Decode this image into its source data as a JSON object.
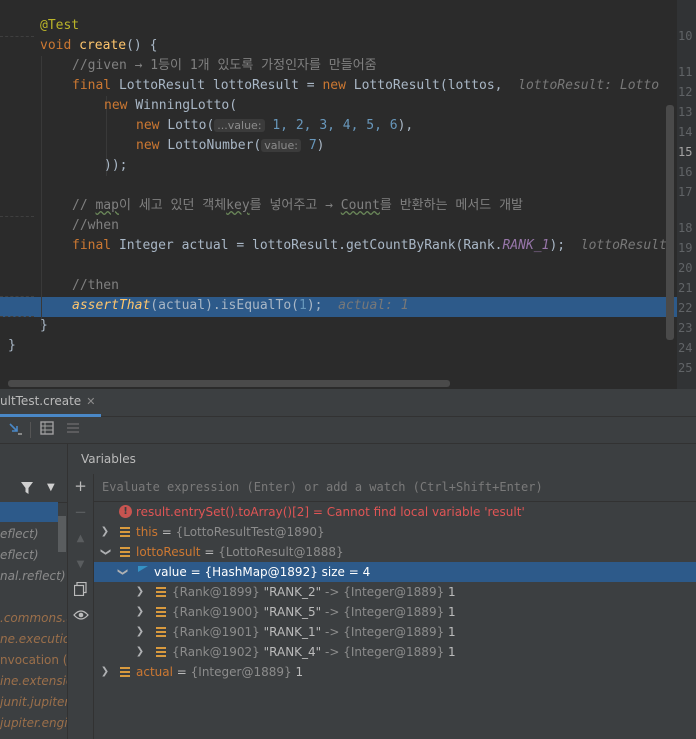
{
  "editor": {
    "line_numbers": [
      "10",
      "11",
      "12",
      "13",
      "14",
      "15",
      "16",
      "17",
      "18",
      "19",
      "20",
      "21",
      "22",
      "23",
      "24",
      "25"
    ],
    "code": {
      "ann_test": "@Test",
      "kw_void": "void ",
      "fn_create": "create",
      "sig_rest": "() {",
      "c_given": "//given → 1등이 1개 있도록 가정인자를 만들어줌",
      "kw_final1": "final ",
      "l3_a": "LottoResult lottoResult = ",
      "kw_new1": "new ",
      "l3_b": "LottoResult(lottos,",
      "l3_hint": "lottoResult: Lotto",
      "kw_new2": "new ",
      "l4": "WinningLotto(",
      "kw_new3": "new ",
      "l5_a": "Lotto(",
      "l5_param": "...value:",
      "l5_nums": "1, 2, 3, 4, 5, 6",
      "l5_end": "),",
      "kw_new4": "new ",
      "l6_a": "LottoNumber(",
      "l6_param": "value:",
      "l6_num": "7",
      "l6_end": ")",
      "l7": "));",
      "c_map_pre": "// ",
      "c_map_word": "map",
      "c_map_mid": "이 세고 있던 객체",
      "c_key_word": "key",
      "c_map_mid2": "를 넣어주고 → ",
      "c_count_word": "Count",
      "c_map_end": "를 반환하는 메서드 개발",
      "c_when": "//when",
      "kw_final2": "final ",
      "l_when_a": "Integer actual = lottoResult.getCountByRank(Rank.",
      "l_when_field": "RANK_1",
      "l_when_end": ");",
      "l_when_hint": "lottoResult",
      "c_then": "//then",
      "l_then_fn": "assertThat",
      "l_then_a": "(actual).isEqualTo(",
      "l_then_num": "1",
      "l_then_end": ");",
      "l_then_hint": "actual: 1",
      "close1": "}",
      "close2": "}"
    }
  },
  "debugger": {
    "tab_title": "ultTest.create",
    "tab_close": "✕",
    "variables_title": "Variables",
    "eval_placeholder": "Evaluate expression (Enter) or add a watch (Ctrl+Shift+Enter)",
    "frames": [
      "eflect)",
      "eflect)",
      "nal.reflect)",
      ".commons.u",
      "ne.execution)",
      "nvocation (or",
      "ine.extensio",
      "junit.jupiter.",
      "jupiter.engin"
    ]
  },
  "variables": [
    {
      "name": "result.entrySet().toArray()[2]",
      "eq": " = ",
      "value": "Cannot find local variable 'result'"
    },
    {
      "name": "this",
      "eq": " = ",
      "ref": "{LottoResultTest@1890}"
    },
    {
      "name": "lottoResult",
      "eq": " = ",
      "ref": "{LottoResult@1888}"
    },
    {
      "name": "value",
      "eq": " = ",
      "ref": "{HashMap@1892}",
      "extra": "size = 4"
    },
    {
      "ref": "{Rank@1899}",
      "key": "\"RANK_2\"",
      "arrow": " -> ",
      "ref2": "{Integer@1889}",
      "val": "1"
    },
    {
      "ref": "{Rank@1900}",
      "key": "\"RANK_5\"",
      "arrow": " -> ",
      "ref2": "{Integer@1889}",
      "val": "1"
    },
    {
      "ref": "{Rank@1901}",
      "key": "\"RANK_1\"",
      "arrow": " -> ",
      "ref2": "{Integer@1889}",
      "val": "1"
    },
    {
      "ref": "{Rank@1902}",
      "key": "\"RANK_4\"",
      "arrow": " -> ",
      "ref2": "{Integer@1889}",
      "val": "1"
    },
    {
      "name": "actual",
      "eq": " = ",
      "ref": "{Integer@1889}",
      "val": "1"
    }
  ]
}
